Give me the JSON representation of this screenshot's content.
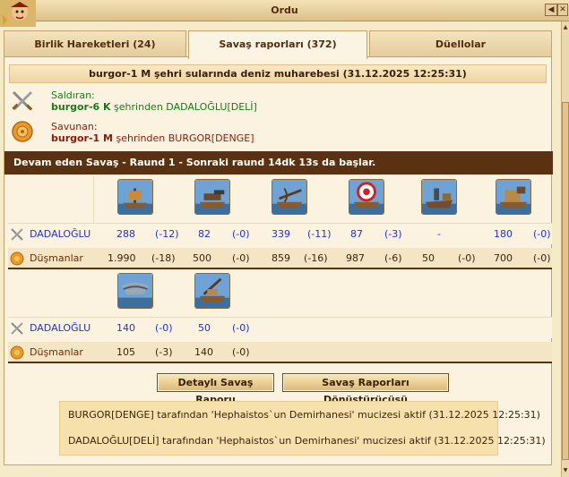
{
  "window": {
    "title": "Ordu",
    "help_icon": "back-arrow-icon",
    "close_icon": "close-icon"
  },
  "tabs": [
    {
      "label": "Birlik Hareketleri (24)"
    },
    {
      "label": "Savaş raporları (372)"
    },
    {
      "label": "Düellolar"
    }
  ],
  "report": {
    "title": "burgor-1 M şehri sularında deniz muharebesi (31.12.2025 12:25:31)",
    "attacker_label": "Saldıran:",
    "attacker_city": "burgor-6 K",
    "attacker_text": " şehrinden DADALOĞLU[DELİ]",
    "defender_label": "Savunan:",
    "defender_city": "burgor-1 M",
    "defender_text": " şehrinden BURGOR[DENGE]",
    "status": "Devam eden Savaş - Raund 1 - Sonraki raund 14dk 13s da başlar."
  },
  "grid1": {
    "units": [
      "fire-ship",
      "bombard-ship",
      "ballista-ship",
      "catapult-ship",
      "steam-ram",
      "mortar-ship"
    ],
    "own_name": "DADALOĞLU",
    "enemy_name": "Düşmanlar",
    "own": [
      {
        "count": "288",
        "loss": "(-12)"
      },
      {
        "count": "82",
        "loss": "(-0)"
      },
      {
        "count": "339",
        "loss": "(-11)"
      },
      {
        "count": "87",
        "loss": "(-3)"
      },
      {
        "count": "-",
        "loss": ""
      },
      {
        "count": "180",
        "loss": "(-0)"
      }
    ],
    "enemy": [
      {
        "count": "1.990",
        "loss": "(-18)"
      },
      {
        "count": "500",
        "loss": "(-0)"
      },
      {
        "count": "859",
        "loss": "(-16)"
      },
      {
        "count": "987",
        "loss": "(-6)"
      },
      {
        "count": "50",
        "loss": "(-0)"
      },
      {
        "count": "700",
        "loss": "(-0)"
      }
    ]
  },
  "grid2": {
    "units": [
      "paddle-speedboat",
      "rocket-ship"
    ],
    "own_name": "DADALOĞLU",
    "enemy_name": "Düşmanlar",
    "own": [
      {
        "count": "140",
        "loss": "(-0)"
      },
      {
        "count": "50",
        "loss": "(-0)"
      }
    ],
    "enemy": [
      {
        "count": "105",
        "loss": "(-3)"
      },
      {
        "count": "140",
        "loss": "(-0)"
      }
    ]
  },
  "buttons": {
    "detailed": "Detaylı Savaş Raporu",
    "converter": "Savaş Raporları Dönüştürücüsü"
  },
  "wonders": [
    "BURGOR[DENGE] tarafından 'Hephaistos`un Demirhanesi' mucizesi aktif (31.12.2025 12:25:31)",
    "DADALOĞLU[DELİ] tarafından 'Hephaistos`un Demirhanesi' mucizesi aktif (31.12.2025 12:25:31)"
  ],
  "colors": {
    "own_blue": "#2133c8",
    "attacker_green": "#1a7a1a",
    "defender_red": "#8a1a0a",
    "banner": "#5a3212"
  }
}
